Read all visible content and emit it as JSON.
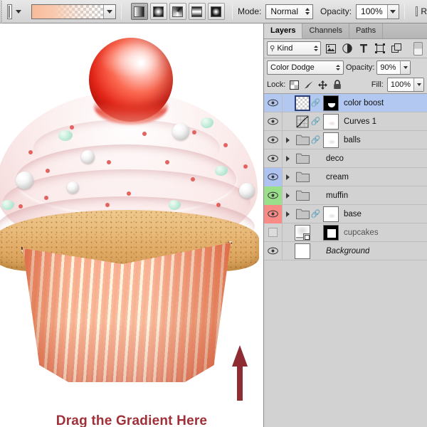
{
  "options_bar": {
    "gradient_preset": {
      "icon": "gradient-preset-swatch",
      "dropdown_icon": "chevron-down-icon"
    },
    "gradient_strip": {
      "icon": "gradient-editor-swatch",
      "from_color": "#f7bb99",
      "to_color": "transparent"
    },
    "gradient_types": [
      {
        "name": "linear-gradient-button",
        "icon": "linear-gradient-icon",
        "active": true
      },
      {
        "name": "radial-gradient-button",
        "icon": "radial-gradient-icon",
        "active": false
      },
      {
        "name": "angle-gradient-button",
        "icon": "angle-gradient-icon",
        "active": false
      },
      {
        "name": "reflected-gradient-button",
        "icon": "reflected-gradient-icon",
        "active": false
      },
      {
        "name": "diamond-gradient-button",
        "icon": "diamond-gradient-icon",
        "active": false
      }
    ],
    "mode_label": "Mode:",
    "mode_value": "Normal",
    "opacity_label": "Opacity:",
    "opacity_value": "100%",
    "reverse_label": "R"
  },
  "canvas": {
    "annotation_text": "Drag the Gradient Here",
    "annotation_color": "#a03038",
    "arrow": "up-arrow-annotation",
    "selection": "marching-ants-selection"
  },
  "panel": {
    "tabs": [
      {
        "label": "Layers",
        "active": true
      },
      {
        "label": "Channels",
        "active": false
      },
      {
        "label": "Paths",
        "active": false
      }
    ],
    "filter": {
      "kind_label": "Kind",
      "search_icon": "search-icon",
      "icons": [
        "pixel-layer-filter-icon",
        "adjustment-layer-filter-icon",
        "type-layer-filter-icon",
        "shape-layer-filter-icon",
        "smart-object-filter-icon"
      ],
      "toggle": "filter-toggle-switch"
    },
    "blend": {
      "mode_value": "Color Dodge",
      "opacity_label": "Opacity:",
      "opacity_value": "90%"
    },
    "lock": {
      "label": "Lock:",
      "icons": [
        "lock-transparency-icon",
        "lock-image-pixels-icon",
        "lock-position-icon",
        "lock-all-icon"
      ],
      "fill_label": "Fill:",
      "fill_value": "100%"
    },
    "layers": [
      {
        "name": "color boost",
        "visible": true,
        "selected": true,
        "label_color": "none",
        "has_disclosure": false,
        "thumb": "transparent",
        "thumb_selected": true,
        "linked": true,
        "mask": "black-mask",
        "italic": false
      },
      {
        "name": "Curves 1",
        "visible": true,
        "selected": false,
        "label_color": "none",
        "has_disclosure": false,
        "thumb": "curves",
        "thumb_selected": false,
        "linked": true,
        "mask": "white-mask",
        "italic": false
      },
      {
        "name": "balls",
        "visible": true,
        "selected": false,
        "label_color": "none",
        "has_disclosure": true,
        "thumb": "folder",
        "thumb_selected": false,
        "linked": true,
        "mask": "white-mask",
        "italic": false
      },
      {
        "name": "deco",
        "visible": true,
        "selected": false,
        "label_color": "none",
        "has_disclosure": true,
        "thumb": "folder",
        "thumb_selected": false,
        "linked": false,
        "mask": "none",
        "italic": false
      },
      {
        "name": "cream",
        "visible": true,
        "selected": false,
        "label_color": "blue",
        "has_disclosure": true,
        "thumb": "folder",
        "thumb_selected": false,
        "linked": false,
        "mask": "none",
        "italic": false
      },
      {
        "name": "muffin",
        "visible": true,
        "selected": false,
        "label_color": "green",
        "has_disclosure": true,
        "thumb": "folder",
        "thumb_selected": false,
        "linked": false,
        "mask": "none",
        "italic": false
      },
      {
        "name": "base",
        "visible": true,
        "selected": false,
        "label_color": "red",
        "has_disclosure": true,
        "thumb": "folder",
        "thumb_selected": false,
        "linked": true,
        "mask": "white-mask",
        "italic": false
      },
      {
        "name": "cupcakes",
        "visible": false,
        "selected": false,
        "label_color": "none",
        "has_disclosure": false,
        "thumb": "artwork-smart-object",
        "thumb_selected": false,
        "linked": false,
        "mask": "black-mask-square",
        "italic": false
      },
      {
        "name": "Background",
        "visible": true,
        "selected": false,
        "label_color": "none",
        "has_disclosure": false,
        "thumb": "white",
        "thumb_selected": false,
        "linked": false,
        "mask": "none",
        "italic": true
      }
    ],
    "colors": {
      "selected_row": "#b3c8f0",
      "label_blue": "#aec3ef",
      "label_green": "#9ae08b",
      "label_red": "#f98b86",
      "panel_bg": "#d2d2d2"
    }
  }
}
